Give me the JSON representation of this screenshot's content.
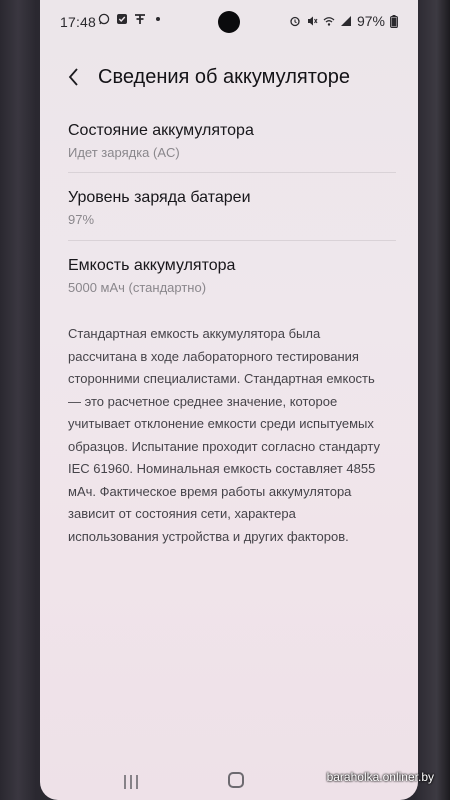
{
  "status_bar": {
    "time": "17:48",
    "battery_percent": "97%",
    "left_icons": [
      "whatsapp-icon",
      "checkbox-icon",
      "notification-icon",
      "dot-icon"
    ],
    "right_icons": [
      "alarm-icon",
      "mute-icon",
      "wifi-icon",
      "signal-icon",
      "battery-icon"
    ]
  },
  "header": {
    "back_icon": "chevron-left-icon",
    "title": "Сведения об аккумуляторе"
  },
  "items": [
    {
      "title": "Состояние аккумулятора",
      "subtitle": "Идет зарядка (AC)"
    },
    {
      "title": "Уровень заряда батареи",
      "subtitle": "97%"
    },
    {
      "title": "Емкость аккумулятора",
      "subtitle": "5000 мАч (стандартно)"
    }
  ],
  "description": "Стандартная емкость аккумулятора была рассчитана в ходе лабораторного тестирования сторонними специалистами. Стандартная емкость — это расчетное среднее значение, которое учитывает отклонение емкости среди испытуемых образцов. Испытание проходит согласно стандарту IEC 61960. Номинальная емкость составляет 4855 мАч. Фактическое время работы аккумулятора зависит от состояния сети, характера использования устройства и других факторов.",
  "navigation": {
    "recents_icon": "recents-icon",
    "home_icon": "home-icon"
  },
  "watermark": "baraholka.onliner.by",
  "colors": {
    "screen_bg": "#efe7ec",
    "title_text": "#141317",
    "secondary_text": "#8a878c"
  }
}
